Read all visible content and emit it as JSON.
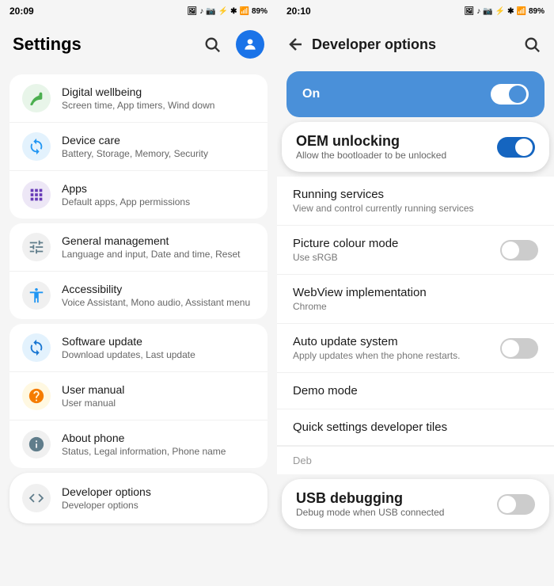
{
  "left": {
    "status_bar": {
      "time": "20:09",
      "battery": "89%"
    },
    "header": {
      "title": "Settings",
      "search_label": "Search",
      "profile_label": "Profile"
    },
    "items": [
      {
        "id": "digital-wellbeing",
        "title": "Digital wellbeing",
        "subtitle": "Screen time, App timers, Wind down",
        "icon_bg": "#e8f5e9",
        "icon_color": "#4caf50",
        "icon": "🌿"
      },
      {
        "id": "device-care",
        "title": "Device care",
        "subtitle": "Battery, Storage, Memory, Security",
        "icon_bg": "#e3f2fd",
        "icon_color": "#2196f3",
        "icon": "⚙"
      },
      {
        "id": "apps",
        "title": "Apps",
        "subtitle": "Default apps, App permissions",
        "icon_bg": "#ede7f6",
        "icon_color": "#673ab7",
        "icon": "⬡"
      },
      {
        "id": "general-management",
        "title": "General management",
        "subtitle": "Language and input, Date and time, Reset",
        "icon_bg": "#f5f5f5",
        "icon_color": "#607d8b",
        "icon": "≡"
      },
      {
        "id": "accessibility",
        "title": "Accessibility",
        "subtitle": "Voice Assistant, Mono audio, Assistant menu",
        "icon_bg": "#f5f5f5",
        "icon_color": "#2196f3",
        "icon": "♿"
      },
      {
        "id": "software-update",
        "title": "Software update",
        "subtitle": "Download updates, Last update",
        "icon_bg": "#e3f2fd",
        "icon_color": "#1976d2",
        "icon": "↻"
      },
      {
        "id": "user-manual",
        "title": "User manual",
        "subtitle": "User manual",
        "icon_bg": "#fff8e1",
        "icon_color": "#f57c00",
        "icon": "?"
      },
      {
        "id": "about-phone",
        "title": "About phone",
        "subtitle": "Status, Legal information, Phone name",
        "icon_bg": "#f5f5f5",
        "icon_color": "#607d8b",
        "icon": "ℹ"
      },
      {
        "id": "developer-options",
        "title": "Developer options",
        "subtitle": "Developer options",
        "icon_bg": "#f5f5f5",
        "icon_color": "#607d8b",
        "icon": "{}"
      }
    ]
  },
  "right": {
    "status_bar": {
      "time": "20:10",
      "battery": "89%"
    },
    "header": {
      "title": "Developer options",
      "back_label": "Back",
      "search_label": "Search"
    },
    "on_toggle": {
      "label": "On",
      "state": true
    },
    "items": [
      {
        "id": "oem-unlocking",
        "title": "OEM unlocking",
        "subtitle": "Allow the bootloader to be unlocked",
        "has_toggle": true,
        "toggle_state": true,
        "highlighted": true
      },
      {
        "id": "running-services",
        "title": "Running services",
        "subtitle": "View and control currently running services",
        "has_toggle": false,
        "highlighted": false
      },
      {
        "id": "picture-colour-mode",
        "title": "Picture colour mode",
        "subtitle": "Use sRGB",
        "has_toggle": true,
        "toggle_state": false,
        "highlighted": false
      },
      {
        "id": "webview-implementation",
        "title": "WebView implementation",
        "subtitle": "Chrome",
        "has_toggle": false,
        "highlighted": false
      },
      {
        "id": "auto-update-system",
        "title": "Auto update system",
        "subtitle": "Apply updates when the phone restarts.",
        "has_toggle": true,
        "toggle_state": false,
        "highlighted": false
      },
      {
        "id": "demo-mode",
        "title": "Demo mode",
        "subtitle": "",
        "has_toggle": false,
        "highlighted": false
      },
      {
        "id": "quick-settings-developer-tiles",
        "title": "Quick settings developer tiles",
        "subtitle": "",
        "has_toggle": false,
        "highlighted": false
      },
      {
        "id": "usb-debugging",
        "title": "USB debugging",
        "subtitle": "Debug mode when USB connected",
        "has_toggle": true,
        "toggle_state": false,
        "highlighted": true
      }
    ],
    "partial_label": "Deb"
  }
}
